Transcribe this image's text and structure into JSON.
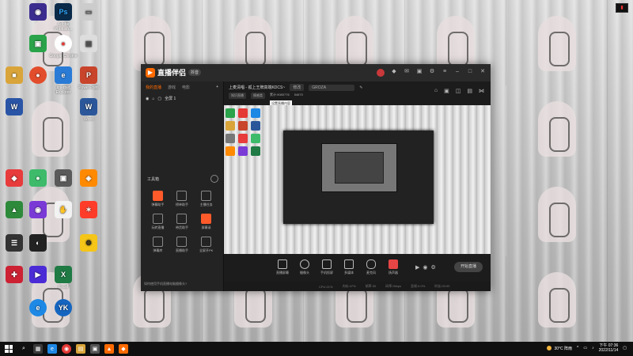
{
  "desktop": {
    "icons": [
      {
        "label": "",
        "color": "#3b2d8f",
        "glyph": "◉"
      },
      {
        "label": "Adobe Photosh...",
        "color": "#0a2a4a",
        "glyph": "Ps"
      },
      {
        "label": "",
        "color": "#cccccc",
        "glyph": "▭"
      },
      {
        "label": "",
        "color": "#2aa34a",
        "glyph": "▣"
      },
      {
        "label": "Google Chrome",
        "color": "#ffffff",
        "glyph": "●"
      },
      {
        "label": "",
        "color": "#dddddd",
        "glyph": "▤"
      },
      {
        "label": "",
        "color": "#d9a53a",
        "glyph": "■"
      },
      {
        "label": "",
        "color": "#e24d2c",
        "glyph": "●"
      },
      {
        "label": "Internet Explorer",
        "color": "#2a7bd6",
        "glyph": "e"
      },
      {
        "label": "PowerPoint",
        "color": "#c8442a",
        "glyph": "P"
      },
      {
        "label": "",
        "color": "#2a55a6",
        "glyph": "W"
      },
      {
        "label": "Word",
        "color": "#2b579a",
        "glyph": "W"
      },
      {
        "label": "Excel",
        "color": "#1f7a44",
        "glyph": "X"
      }
    ]
  },
  "app": {
    "name": "直播伴侣",
    "version": "抖音",
    "left_tabs": [
      "我的直播",
      "游戏",
      "电影"
    ],
    "scene_label": "全屏 1",
    "tools_title": "工具箱",
    "tools": [
      {
        "label": "弹幕助手",
        "hot": true
      },
      {
        "label": "榜单助手",
        "hot": false
      },
      {
        "label": "主播任务",
        "hot": false
      },
      {
        "label": "玩转直播",
        "hot": false
      },
      {
        "label": "带货助手",
        "hot": false
      },
      {
        "label": "屏幕录",
        "hot": true
      },
      {
        "label": "弹幕库",
        "hot": false
      },
      {
        "label": "直播助手",
        "hot": false
      },
      {
        "label": "全屏开PK",
        "hot": false
      }
    ],
    "left_footer": "如何使用手机直播电脑摄像头?",
    "stream_title": "上麦清唱 - 孤上王牌高端KDCS~",
    "title_pill": "修改",
    "room_pill": "GROZA",
    "tags": [
      "知识直播",
      "情感类"
    ],
    "viewers_label": "累计:9080776",
    "likes_label": "54670",
    "tooltip": "设置直播内容",
    "bottom_tools": [
      {
        "label": "直播屏幕",
        "red": false
      },
      {
        "label": "摄像头",
        "red": false
      },
      {
        "label": "手机投屏",
        "red": false
      },
      {
        "label": "多媒体",
        "red": false
      },
      {
        "label": "麦克风",
        "red": false
      },
      {
        "label": "扬声器",
        "red": true
      }
    ],
    "go_live": "开始直播",
    "status": [
      "CPU:21%",
      "内存:47%",
      "帧率:30",
      "码率:0kbps",
      "丢帧:0.0%",
      "时长:00:00"
    ]
  },
  "taskbar": {
    "apps": [
      {
        "color": "#ffffff",
        "glyph": "⌕"
      },
      {
        "color": "#3a3a3a",
        "glyph": "▦"
      },
      {
        "color": "#1e88e5",
        "glyph": "e"
      },
      {
        "color": "#e53935",
        "glyph": "◉"
      },
      {
        "color": "#d9a53a",
        "glyph": "▤"
      },
      {
        "color": "#555555",
        "glyph": "▣"
      },
      {
        "color": "#ff6a00",
        "glyph": "▲"
      },
      {
        "color": "#ff6a00",
        "glyph": "◆"
      }
    ],
    "weather": "30°C 阵雨",
    "time": "下午 07:36",
    "date": "2022/11/14"
  }
}
